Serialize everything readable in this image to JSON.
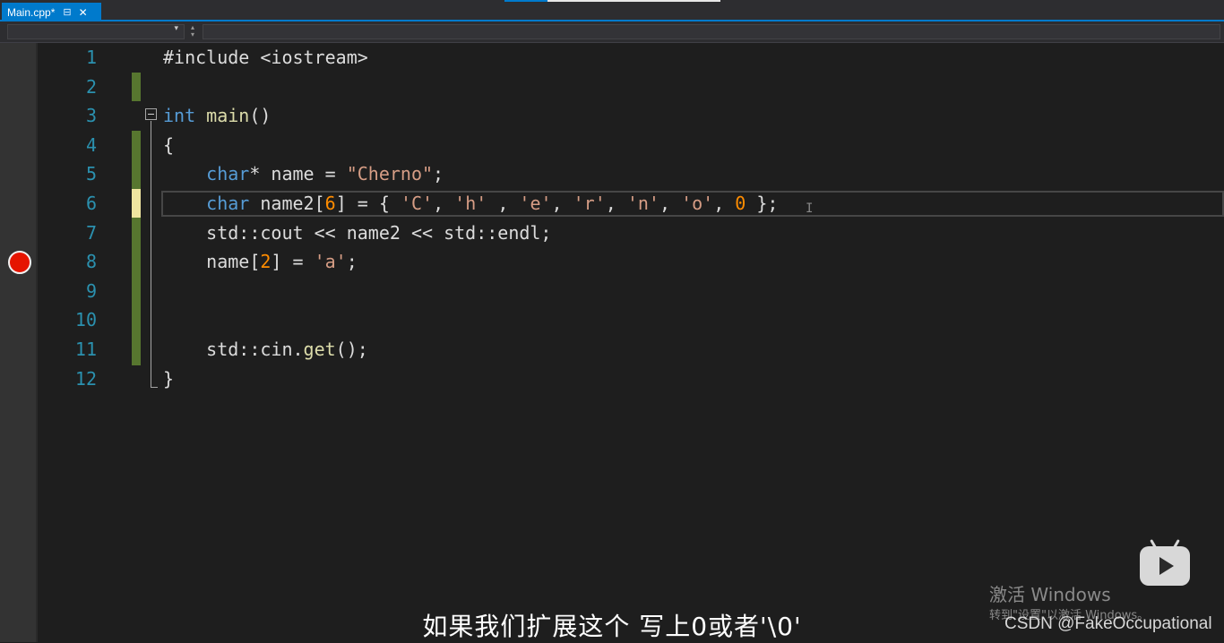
{
  "tab": {
    "title": "Main.cpp*",
    "pin_icon": "pin-icon",
    "close_icon": "close-icon"
  },
  "breakpoint_line": 8,
  "code": {
    "lines": [
      {
        "num": "1",
        "tokens": [
          {
            "t": "#include <iostream>",
            "c": ""
          }
        ]
      },
      {
        "num": "2",
        "tokens": []
      },
      {
        "num": "3",
        "tokens": [
          {
            "t": "int",
            "c": "kw"
          },
          {
            "t": " ",
            "c": ""
          },
          {
            "t": "main",
            "c": "fn"
          },
          {
            "t": "()",
            "c": ""
          }
        ]
      },
      {
        "num": "4",
        "tokens": [
          {
            "t": "{",
            "c": ""
          }
        ]
      },
      {
        "num": "5",
        "tokens": [
          {
            "t": "    ",
            "c": ""
          },
          {
            "t": "char",
            "c": "kw"
          },
          {
            "t": "* name = ",
            "c": ""
          },
          {
            "t": "\"Cherno\"",
            "c": "str"
          },
          {
            "t": ";",
            "c": ""
          }
        ]
      },
      {
        "num": "6",
        "tokens": [
          {
            "t": "    ",
            "c": ""
          },
          {
            "t": "char",
            "c": "kw"
          },
          {
            "t": " name2[",
            "c": ""
          },
          {
            "t": "6",
            "c": "hl"
          },
          {
            "t": "] = { ",
            "c": ""
          },
          {
            "t": "'C'",
            "c": "str"
          },
          {
            "t": ", ",
            "c": ""
          },
          {
            "t": "'h'",
            "c": "str"
          },
          {
            "t": " , ",
            "c": ""
          },
          {
            "t": "'e'",
            "c": "str"
          },
          {
            "t": ", ",
            "c": ""
          },
          {
            "t": "'r'",
            "c": "str"
          },
          {
            "t": ", ",
            "c": ""
          },
          {
            "t": "'n'",
            "c": "str"
          },
          {
            "t": ", ",
            "c": ""
          },
          {
            "t": "'o'",
            "c": "str"
          },
          {
            "t": ", ",
            "c": ""
          },
          {
            "t": "0",
            "c": "hl"
          },
          {
            "t": " };",
            "c": ""
          }
        ]
      },
      {
        "num": "7",
        "tokens": [
          {
            "t": "    std::cout << name2 << std::endl;",
            "c": ""
          }
        ]
      },
      {
        "num": "8",
        "tokens": [
          {
            "t": "    name[",
            "c": ""
          },
          {
            "t": "2",
            "c": "hl"
          },
          {
            "t": "] = ",
            "c": ""
          },
          {
            "t": "'a'",
            "c": "str"
          },
          {
            "t": ";",
            "c": ""
          }
        ]
      },
      {
        "num": "9",
        "tokens": []
      },
      {
        "num": "10",
        "tokens": []
      },
      {
        "num": "11",
        "tokens": [
          {
            "t": "    std::cin.",
            "c": ""
          },
          {
            "t": "get",
            "c": "fn"
          },
          {
            "t": "();",
            "c": ""
          }
        ]
      },
      {
        "num": "12",
        "tokens": [
          {
            "t": "}",
            "c": ""
          }
        ]
      }
    ]
  },
  "subtitle": "如果我们扩展这个 写上0或者'\\0'",
  "windows_activation": {
    "title": "激活 Windows",
    "subtitle": "转到\"设置\"以激活 Windows。"
  },
  "watermark": "CSDN @FakeOccupational",
  "colors": {
    "keyword": "#569cd6",
    "function": "#dcdcaa",
    "string": "#d69d85",
    "highlight_number": "#ff8c00",
    "line_number": "#2b91af",
    "breakpoint": "#e51400",
    "tab_accent": "#007acc"
  }
}
